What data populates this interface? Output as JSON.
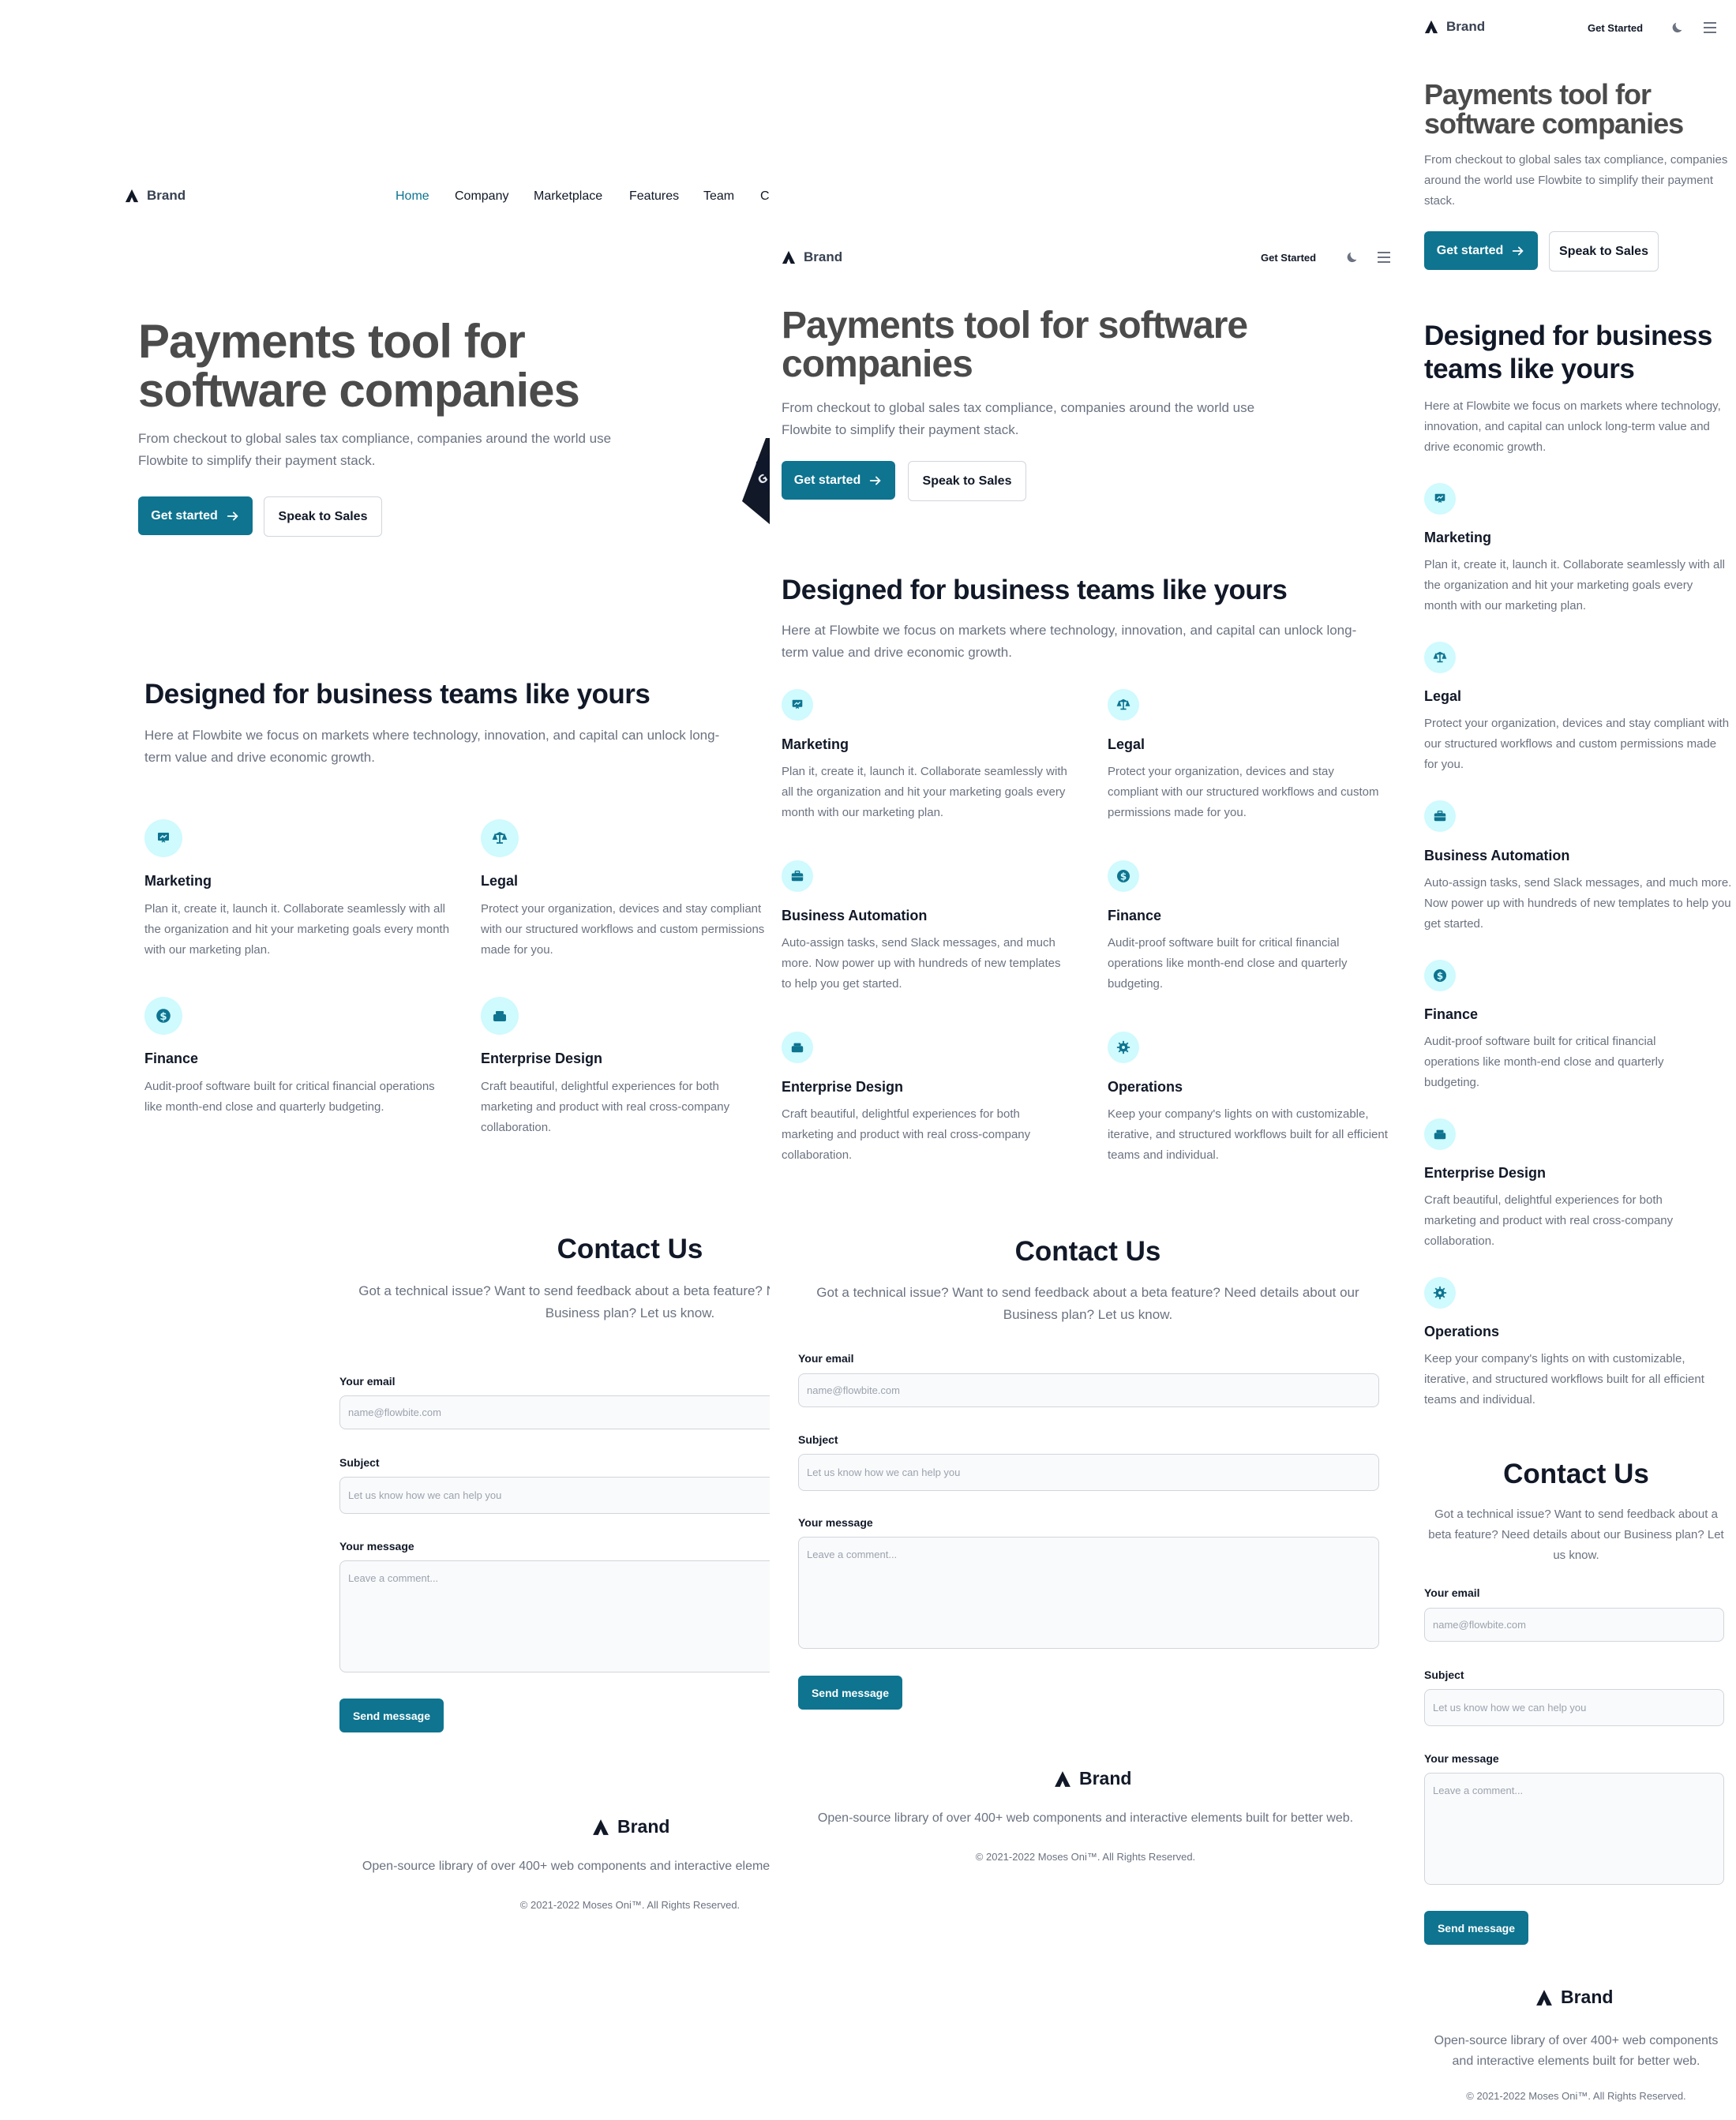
{
  "brand": "Brand",
  "nav": {
    "links": [
      "Home",
      "Company",
      "Marketplace",
      "Features",
      "Team",
      "Contact"
    ],
    "cta": "Get Started"
  },
  "hero": {
    "title": "Payments tool for software companies",
    "subtitle": "From checkout to global sales tax compliance, companies around the world use Flowbite to simplify their payment stack.",
    "primary": "Get started",
    "secondary": "Speak to Sales"
  },
  "features": {
    "title": "Designed for business teams like yours",
    "subtitle": "Here at Flowbite we focus on markets where technology, innovation, and capital can unlock long-term value and drive economic growth.",
    "items": [
      {
        "icon": "presentation-chart-icon",
        "title": "Marketing",
        "desc": "Plan it, create it, launch it. Collaborate seamlessly with all the organization and hit your marketing goals every month with our marketing plan."
      },
      {
        "icon": "scale-icon",
        "title": "Legal",
        "desc": "Protect your organization, devices and stay compliant with our structured workflows and custom permissions made for you."
      },
      {
        "icon": "briefcase-icon",
        "title": "Business Automation",
        "desc": "Auto-assign tasks, send Slack messages, and much more. Now power up with hundreds of new templates to help you get started."
      },
      {
        "icon": "dollar-icon",
        "title": "Finance",
        "desc": "Audit-proof software built for critical financial operations like month-end close and quarterly budgeting."
      },
      {
        "icon": "design-icon",
        "title": "Enterprise Design",
        "desc": "Craft beautiful, delightful experiences for both marketing and product with real cross-company collaboration."
      },
      {
        "icon": "cog-icon",
        "title": "Operations",
        "desc": "Keep your company's lights on with customizable, iterative, and structured workflows built for all efficient teams and individual."
      }
    ]
  },
  "contact": {
    "title": "Contact Us",
    "subtitle": "Got a technical issue? Want to send feedback about a beta feature? Need details about our Business plan? Let us know.",
    "email_label": "Your email",
    "email_placeholder": "name@flowbite.com",
    "subject_label": "Subject",
    "subject_placeholder": "Let us know how we can help you",
    "message_label": "Your message",
    "message_placeholder": "Leave a comment...",
    "send": "Send message"
  },
  "footer": {
    "desc": "Open-source library of over 400+ web components and interactive elements built for better web.",
    "copyright": "© 2021-2022 Moses Oni™. All Rights Reserved."
  },
  "colors": {
    "accent": "#0e7490",
    "icon_bg": "#cffafe",
    "text": "#111827",
    "muted": "#6b7280"
  }
}
